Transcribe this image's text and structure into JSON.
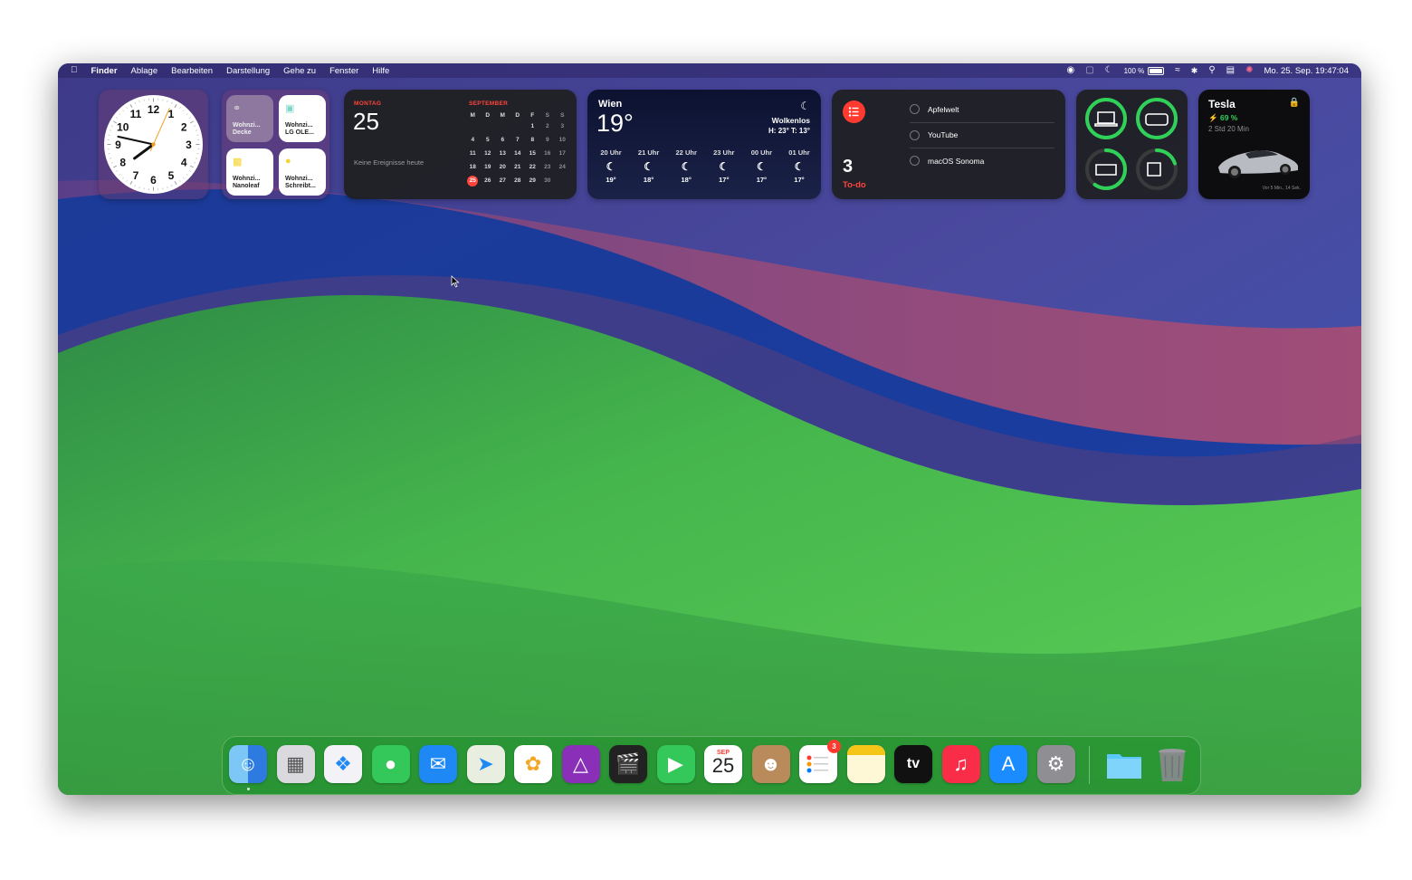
{
  "menubar": {
    "apple_icon": "apple-logo",
    "app_name": "Finder",
    "menus": [
      "Ablage",
      "Bearbeiten",
      "Darstellung",
      "Gehe zu",
      "Fenster",
      "Hilfe"
    ],
    "battery_text": "100 %",
    "datetime": "Mo. 25. Sep.  19:47:04"
  },
  "widgets": {
    "clock": {
      "hour": 19,
      "minute": 47,
      "second": 4,
      "numbers": [
        "12",
        "1",
        "2",
        "3",
        "4",
        "5",
        "6",
        "7",
        "8",
        "9",
        "10",
        "11"
      ]
    },
    "home": {
      "tiles": [
        {
          "label": "Wohnzi...\nDecke",
          "icon": "ceiling-lamp-icon",
          "on": false
        },
        {
          "label": "Wohnzi...\nLG OLE...",
          "icon": "tv-icon",
          "on": true
        },
        {
          "label": "Wohnzi...\nNanoleaf",
          "icon": "light-panel-icon",
          "on": true
        },
        {
          "label": "Wohnzi...\nSchreibt...",
          "icon": "desk-lamp-icon",
          "on": true
        }
      ]
    },
    "calendar": {
      "weekday": "MONTAG",
      "day": "25",
      "no_events": "Keine Ereignisse heute",
      "month": "SEPTEMBER",
      "weekday_headers": [
        "M",
        "D",
        "M",
        "D",
        "F",
        "S",
        "S"
      ],
      "weeks": [
        [
          "",
          "",
          "",
          "",
          "1",
          "2",
          "3"
        ],
        [
          "4",
          "5",
          "6",
          "7",
          "8",
          "9",
          "10"
        ],
        [
          "11",
          "12",
          "13",
          "14",
          "15",
          "16",
          "17"
        ],
        [
          "18",
          "19",
          "20",
          "21",
          "22",
          "23",
          "24"
        ],
        [
          "25",
          "26",
          "27",
          "28",
          "29",
          "30",
          ""
        ]
      ],
      "today": "25"
    },
    "weather": {
      "city": "Wien",
      "temp": "19°",
      "condition": "Wolkenlos",
      "hilo": "H: 23° T: 13°",
      "hourly": [
        {
          "time": "20 Uhr",
          "temp": "19°",
          "icon": "moon-icon"
        },
        {
          "time": "21 Uhr",
          "temp": "18°",
          "icon": "moon-icon"
        },
        {
          "time": "22 Uhr",
          "temp": "18°",
          "icon": "moon-icon"
        },
        {
          "time": "23 Uhr",
          "temp": "17°",
          "icon": "moon-icon"
        },
        {
          "time": "00 Uhr",
          "temp": "17°",
          "icon": "moon-icon"
        },
        {
          "time": "01 Uhr",
          "temp": "17°",
          "icon": "moon-icon"
        }
      ]
    },
    "reminders": {
      "count": "3",
      "list_name": "To-do",
      "items": [
        "Apfelwelt",
        "YouTube",
        "macOS Sonoma"
      ]
    },
    "batteries": {
      "devices": [
        {
          "name": "laptop-icon",
          "level": 1.0
        },
        {
          "name": "airpods-case-icon",
          "level": 1.0
        },
        {
          "name": "keyboard-icon",
          "level": 0.6
        },
        {
          "name": "trackpad-icon",
          "level": 0.2
        }
      ],
      "color": "#30d158"
    },
    "tesla": {
      "name": "Tesla",
      "battery": "69 %",
      "time_remaining": "2 Std 20 Min",
      "updated": "Vor 5 Min., 14 Sek."
    }
  },
  "dock": {
    "apps": [
      {
        "name": "finder-icon",
        "running": true
      },
      {
        "name": "launchpad-icon",
        "running": false
      },
      {
        "name": "safari-icon",
        "running": false
      },
      {
        "name": "messages-icon",
        "running": false
      },
      {
        "name": "mail-icon",
        "running": false
      },
      {
        "name": "maps-icon",
        "running": false
      },
      {
        "name": "photos-icon",
        "running": false
      },
      {
        "name": "affinity-photo-icon",
        "running": false
      },
      {
        "name": "final-cut-pro-icon",
        "running": false
      },
      {
        "name": "facetime-icon",
        "running": false
      },
      {
        "name": "calendar-icon",
        "running": false,
        "month": "SEP",
        "day": "25"
      },
      {
        "name": "contacts-icon",
        "running": false
      },
      {
        "name": "reminders-icon",
        "running": false,
        "badge": "3"
      },
      {
        "name": "notes-icon",
        "running": false
      },
      {
        "name": "apple-tv-icon",
        "running": false,
        "text": "tv"
      },
      {
        "name": "music-icon",
        "running": false
      },
      {
        "name": "app-store-icon",
        "running": false
      },
      {
        "name": "system-settings-icon",
        "running": false
      }
    ],
    "extras": [
      "downloads-folder-icon",
      "trash-icon"
    ]
  },
  "colors": {
    "accent_red": "#ff453a",
    "battery_green": "#30d158",
    "wallpaper_green": "#4cc44a",
    "wallpaper_blue": "#1f3e9a"
  }
}
